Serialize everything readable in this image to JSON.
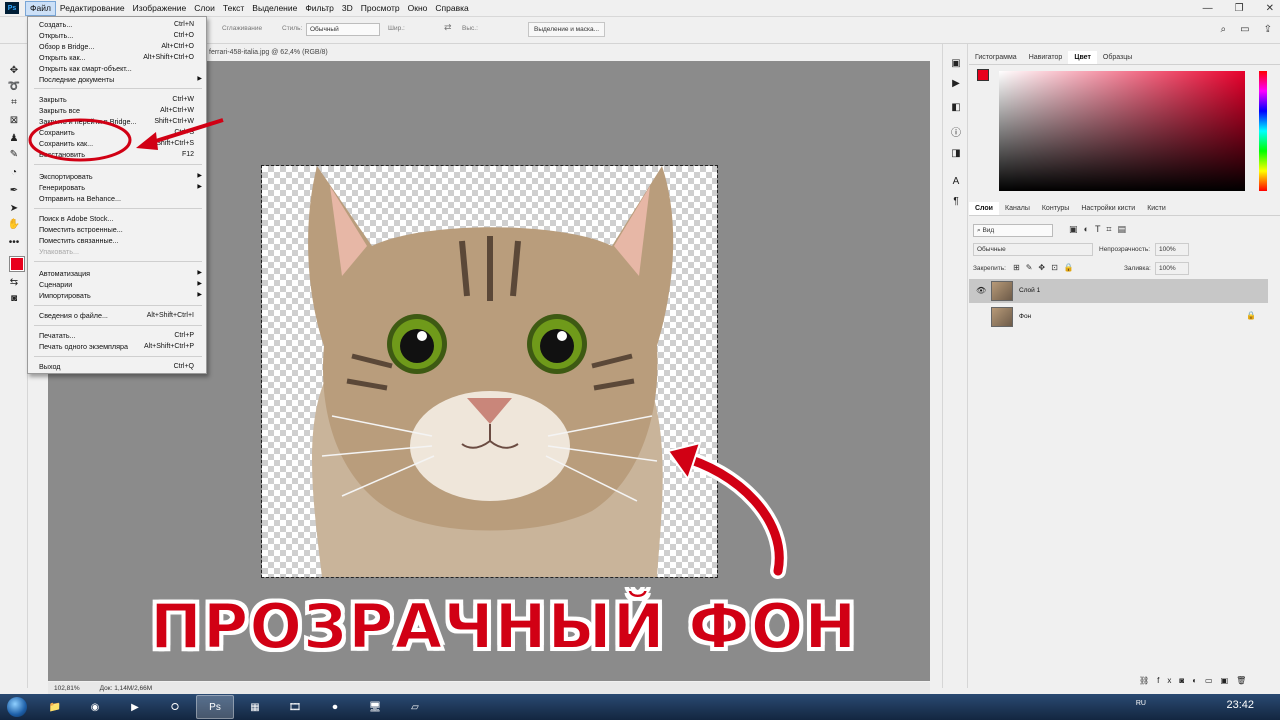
{
  "menubar": {
    "items": [
      "Файл",
      "Редактирование",
      "Изображение",
      "Слои",
      "Текст",
      "Выделение",
      "Фильтр",
      "3D",
      "Просмотр",
      "Окно",
      "Справка"
    ]
  },
  "options": {
    "smoothing": "Сглаживание",
    "style_label": "Стиль:",
    "style_value": "Обычный",
    "width_label": "Шир.:",
    "height_label": "Выс.:",
    "select_mask": "Выделение и маска..."
  },
  "doc": {
    "tab": "ferrari-458-italia.jpg @ 62,4% (RGB/8)",
    "zoom": "102,81%",
    "doc_size": "Док: 1,14M/2,66M"
  },
  "file_menu": {
    "items": [
      {
        "label": "Создать...",
        "shortcut": "Ctrl+N"
      },
      {
        "label": "Открыть...",
        "shortcut": "Ctrl+O"
      },
      {
        "label": "Обзор в Bridge...",
        "shortcut": "Alt+Ctrl+O"
      },
      {
        "label": "Открыть как...",
        "shortcut": "Alt+Shift+Ctrl+O"
      },
      {
        "label": "Открыть как смарт-объект...",
        "shortcut": ""
      },
      {
        "label": "Последние документы",
        "shortcut": ""
      },
      {
        "label": "Закрыть",
        "shortcut": "Ctrl+W"
      },
      {
        "label": "Закрыть все",
        "shortcut": "Alt+Ctrl+W"
      },
      {
        "label": "Закрыть и перейти в Bridge...",
        "shortcut": "Shift+Ctrl+W"
      },
      {
        "label": "Сохранить",
        "shortcut": "Ctrl+S"
      },
      {
        "label": "Сохранить как...",
        "shortcut": "Shift+Ctrl+S"
      },
      {
        "label": "Восстановить",
        "shortcut": "F12"
      },
      {
        "label": "Экспортировать",
        "shortcut": ""
      },
      {
        "label": "Генерировать",
        "shortcut": ""
      },
      {
        "label": "Отправить на Behance...",
        "shortcut": ""
      },
      {
        "label": "Поиск в Adobe Stock...",
        "shortcut": ""
      },
      {
        "label": "Поместить встроенные...",
        "shortcut": ""
      },
      {
        "label": "Поместить связанные...",
        "shortcut": ""
      },
      {
        "label": "Упаковать...",
        "shortcut": ""
      },
      {
        "label": "Автоматизация",
        "shortcut": ""
      },
      {
        "label": "Сценарии",
        "shortcut": ""
      },
      {
        "label": "Импортировать",
        "shortcut": ""
      },
      {
        "label": "Сведения о файле...",
        "shortcut": "Alt+Shift+Ctrl+I"
      },
      {
        "label": "Печатать...",
        "shortcut": "Ctrl+P"
      },
      {
        "label": "Печать одного экземпляра",
        "shortcut": "Alt+Shift+Ctrl+P"
      },
      {
        "label": "Выход",
        "shortcut": "Ctrl+Q"
      }
    ]
  },
  "color_panel": {
    "tabs": [
      "Гистограмма",
      "Навигатор",
      "Цвет",
      "Образцы"
    ],
    "active_tab": "Цвет",
    "fg_color": "#e8001c"
  },
  "layers_panel": {
    "tabs": [
      "Слои",
      "Каналы",
      "Контуры",
      "Настройки кисти",
      "Кисти"
    ],
    "filter_placeholder": "Вид",
    "blend_mode": "Обычные",
    "opacity_label": "Непрозрачность:",
    "opacity_value": "100%",
    "lock_label": "Закрепить:",
    "fill_label": "Заливка:",
    "fill_value": "100%",
    "layers": [
      {
        "name": "Слой 1",
        "selected": true
      },
      {
        "name": "Фон",
        "selected": false
      }
    ]
  },
  "annotation": {
    "title": "ПРОЗРАЧНЫЙ ФОН"
  },
  "taskbar": {
    "lang": "RU",
    "clock": "23:42"
  }
}
